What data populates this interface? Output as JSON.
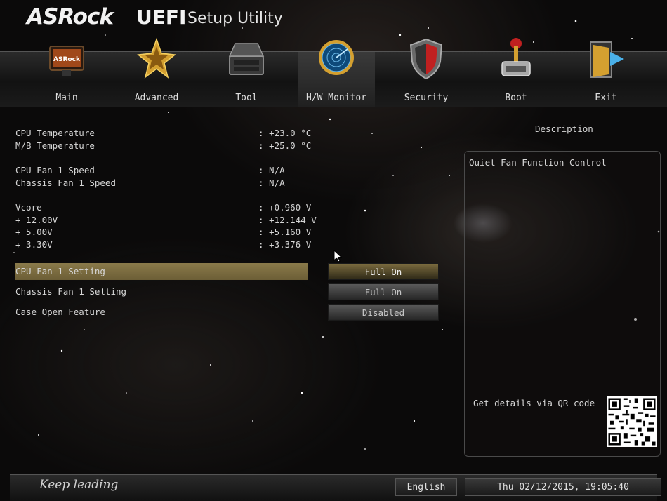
{
  "header": {
    "brand": "ASRock",
    "title_strong": "UEFI",
    "title_rest": "Setup Utility"
  },
  "tabs": [
    {
      "label": "Main",
      "icon": "monitor-icon",
      "active": false
    },
    {
      "label": "Advanced",
      "icon": "star-icon",
      "active": false
    },
    {
      "label": "Tool",
      "icon": "toolbox-icon",
      "active": false
    },
    {
      "label": "H/W Monitor",
      "icon": "radar-icon",
      "active": true
    },
    {
      "label": "Security",
      "icon": "shield-icon",
      "active": false
    },
    {
      "label": "Boot",
      "icon": "joystick-icon",
      "active": false
    },
    {
      "label": "Exit",
      "icon": "exit-door-icon",
      "active": false
    }
  ],
  "monitor": {
    "cpu_temp": {
      "label": "CPU Temperature",
      "value": ": +23.0 °C"
    },
    "mb_temp": {
      "label": "M/B Temperature",
      "value": ": +25.0 °C"
    },
    "cpu_fan": {
      "label": "CPU Fan 1 Speed",
      "value": ": N/A"
    },
    "chassis_fan": {
      "label": "Chassis Fan 1 Speed",
      "value": ": N/A"
    },
    "vcore": {
      "label": "Vcore",
      "value": ": +0.960 V"
    },
    "v12": {
      "label": "+ 12.00V",
      "value": ": +12.144 V"
    },
    "v5": {
      "label": "+ 5.00V",
      "value": ": +5.160 V"
    },
    "v33": {
      "label": "+ 3.30V",
      "value": ": +3.376 V"
    }
  },
  "settings": {
    "cpu_fan_setting": {
      "label": "CPU Fan 1 Setting",
      "value": "Full On"
    },
    "chassis_fan_setting": {
      "label": "Chassis Fan 1 Setting",
      "value": "Full On"
    },
    "case_open": {
      "label": "Case Open Feature",
      "value": "Disabled"
    }
  },
  "description": {
    "title": "Description",
    "text": "Quiet Fan Function Control",
    "qr_text": "Get details via QR code"
  },
  "footer": {
    "slogan": "Keep leading",
    "language": "English",
    "datetime": "Thu 02/12/2015, 19:05:40"
  },
  "colors": {
    "accent_gold": "#8a7a4a",
    "background": "#0b0a0a"
  }
}
